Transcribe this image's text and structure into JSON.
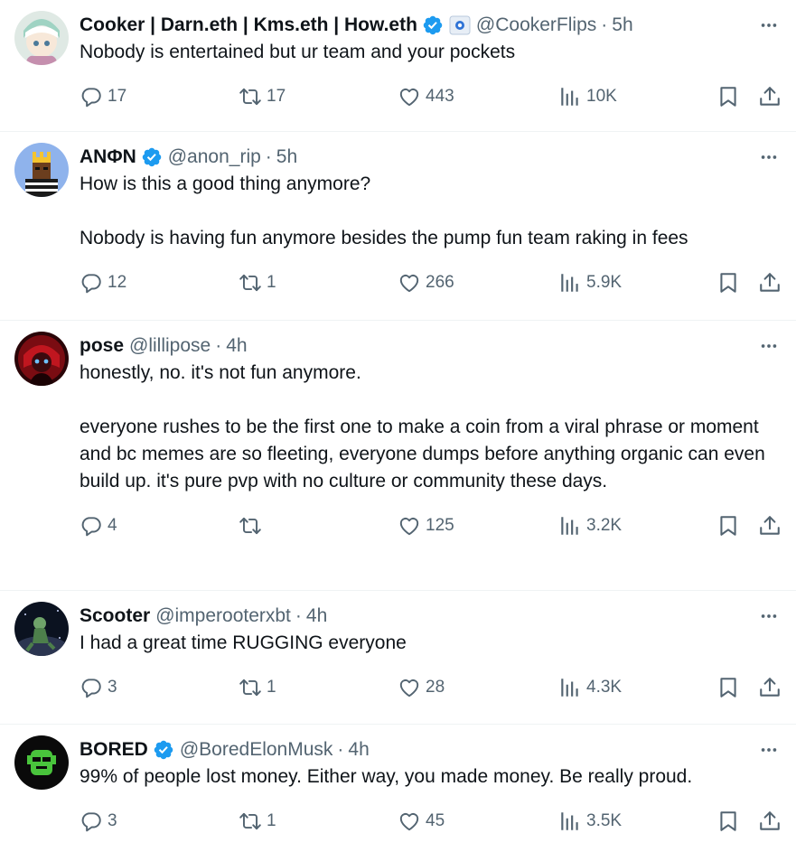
{
  "tweets": [
    {
      "name": "Cooker | Darn.eth | Kms.eth | How.eth",
      "handle": "@CookerFlips",
      "time": "5h",
      "text": "Nobody is entertained but ur team and your pockets",
      "replies": "17",
      "retweets": "17",
      "likes": "443",
      "views": "10K"
    },
    {
      "name": "ANΦN",
      "handle": "@anon_rip",
      "time": "5h",
      "text": "How is this a good thing anymore?\n\nNobody is having fun anymore besides the pump fun team raking in fees",
      "replies": "12",
      "retweets": "1",
      "likes": "266",
      "views": "5.9K"
    },
    {
      "name": "pose",
      "handle": "@lillipose",
      "time": "4h",
      "text": "honestly, no. it's not fun anymore.\n\neveryone rushes to be the first one to make a coin from a viral phrase or moment and bc memes are so fleeting, everyone dumps before anything organic can even build up. it's pure pvp with no culture or community these days.",
      "replies": "4",
      "retweets": "",
      "likes": "125",
      "views": "3.2K"
    },
    {
      "name": "Scooter",
      "handle": "@imperooterxbt",
      "time": "4h",
      "text": "I had a great time RUGGING everyone",
      "replies": "3",
      "retweets": "1",
      "likes": "28",
      "views": "4.3K"
    },
    {
      "name": "BORED",
      "handle": "@BoredElonMusk",
      "time": "4h",
      "text": "99% of people lost money. Either way, you made money. Be really proud.",
      "replies": "3",
      "retweets": "1",
      "likes": "45",
      "views": "3.5K"
    }
  ],
  "separator": "·",
  "colors": {
    "verified": "#1d9bf0",
    "secondary_text": "#536471",
    "primary_text": "#0f1419",
    "divider": "#eff3f4"
  }
}
